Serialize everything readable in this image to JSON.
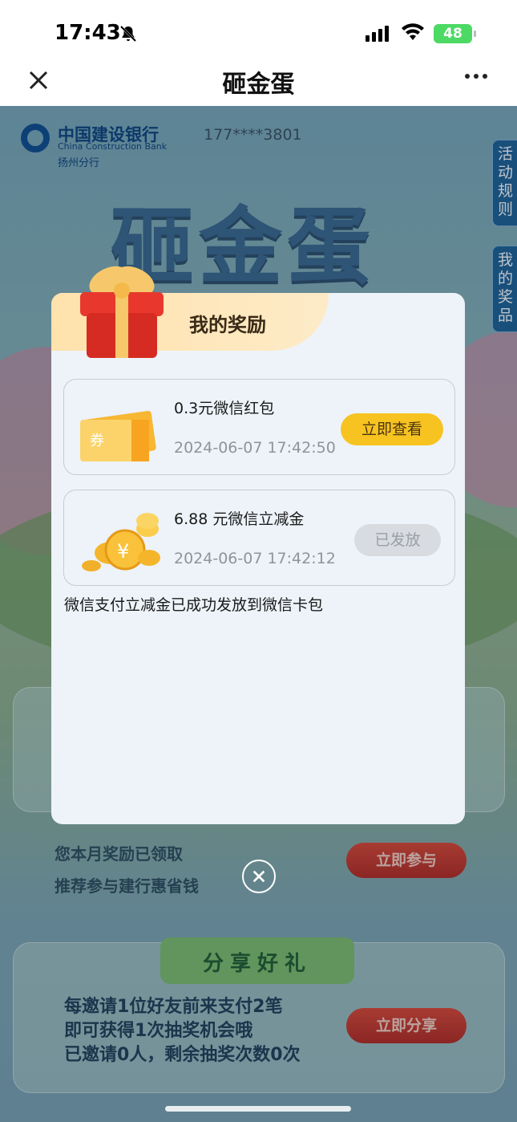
{
  "status_bar": {
    "time": "17:43",
    "battery": "48"
  },
  "nav": {
    "title": "砸金蛋"
  },
  "page": {
    "bank_name": "中国建设银行",
    "bank_name_en": "China Construction Bank",
    "bank_branch": "扬州分行",
    "phone": "177****3801",
    "big_title": "砸金蛋",
    "side_tabs": [
      "活动规则",
      "我的奖品"
    ],
    "card1": {
      "line1": "您本月奖励已领取",
      "line2": "推荐参与建行惠省钱",
      "button": "立即参与"
    },
    "card2": {
      "title": "分享好礼",
      "line1": "每邀请1位好友前来支付2笔",
      "line2": "即可获得1次抽奖机会哦",
      "line3": "已邀请0人，剩余抽奖次数0次",
      "button": "立即分享"
    }
  },
  "dialog": {
    "title": "我的奖励",
    "rewards": [
      {
        "name": "0.3元微信红包",
        "time": "2024-06-07 17:42:50",
        "action": "立即查看",
        "icon": "coupon-ticket-icon",
        "coupon_text": "券"
      },
      {
        "name": "6.88 元微信立减金",
        "time": "2024-06-07 17:42:12",
        "action": "已发放",
        "icon": "gold-coins-icon"
      }
    ],
    "tip": "微信支付立减金已成功发放到微信卡包"
  }
}
